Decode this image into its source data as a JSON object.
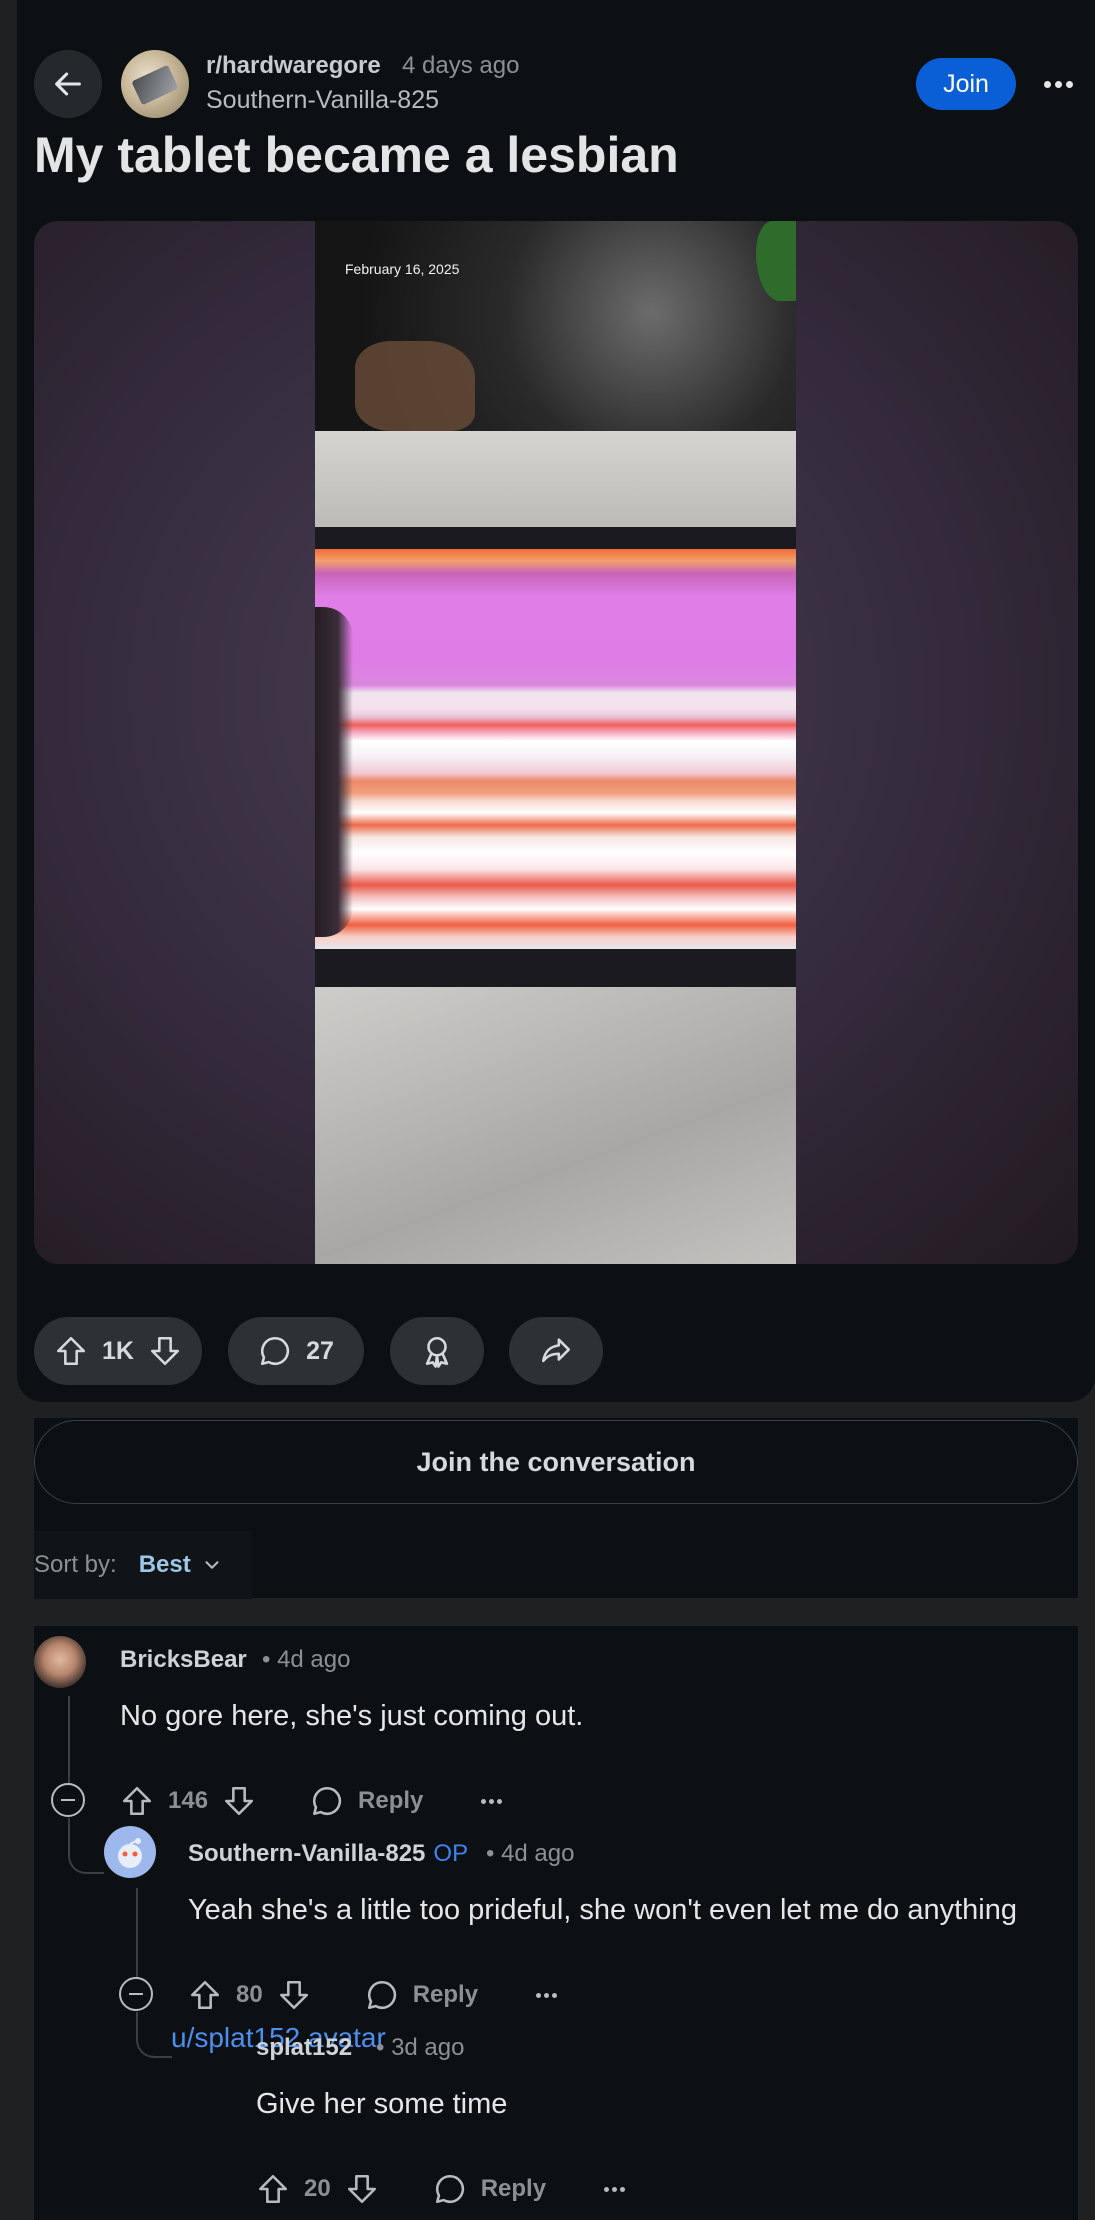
{
  "post": {
    "subreddit": "r/hardwaregore",
    "time": "4 days ago",
    "author": "Southern-Vanilla-825",
    "join_label": "Join",
    "title": "My tablet became a lesbian",
    "photo_date": "February 16, 2025"
  },
  "actions": {
    "votes": "1K",
    "comments": "27"
  },
  "conversation": {
    "join_label": "Join the conversation",
    "sort_label": "Sort by:",
    "sort_value": "Best"
  },
  "comments": [
    {
      "user": "BricksBear",
      "meta": "• 4d ago",
      "text": "No gore here, she's just coming out.",
      "votes": "146",
      "reply_label": "Reply"
    },
    {
      "user": "Southern-Vanilla-825",
      "op_tag": "OP",
      "meta": "• 4d ago",
      "text": "Yeah she's a little too prideful, she won't even let me do anything",
      "votes": "80",
      "reply_label": "Reply"
    },
    {
      "avatar_alt": "u/splat152 avatar",
      "user": "splat152",
      "meta": "• 3d ago",
      "text": "Give her some time",
      "votes": "20",
      "reply_label": "Reply"
    }
  ],
  "colors": {
    "background": "#0d1012",
    "join_button": "#0a5fd6",
    "op_tag": "#3e82f2",
    "sort_value": "#9dc7e8"
  },
  "icons": [
    "back-arrow-icon",
    "more-icon",
    "upvote-icon",
    "downvote-icon",
    "comment-icon",
    "award-icon",
    "share-icon",
    "chevron-down-icon",
    "collapse-icon"
  ]
}
